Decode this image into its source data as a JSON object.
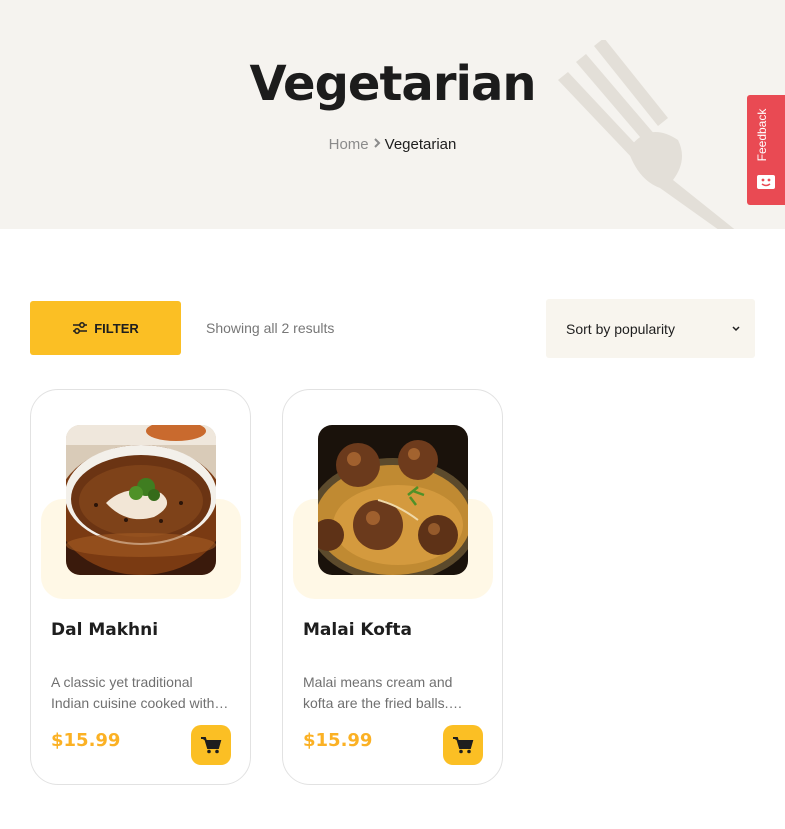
{
  "hero": {
    "title": "Vegetarian",
    "breadcrumb": {
      "home": "Home",
      "separator": "›",
      "current": "Vegetarian"
    }
  },
  "feedback": {
    "label": "Feedback"
  },
  "toolbar": {
    "filter_label": "FILTER",
    "result_count": "Showing all 2 results",
    "sort_selected": "Sort by popularity"
  },
  "products": [
    {
      "title": "Dal Makhni",
      "desc_line1": "A classic yet traditional",
      "desc_line2": "Indian cuisine cooked with…",
      "price": "$15.99",
      "image_icon": "dal-makhni-bowl"
    },
    {
      "title": "Malai Kofta",
      "desc_line1": "Malai means cream and",
      "desc_line2": "kofta are the fried balls.…",
      "price": "$15.99",
      "image_icon": "malai-kofta-plate"
    }
  ],
  "colors": {
    "accent": "#fbbf24",
    "price": "#fbb124",
    "hero_bg": "#f5f3ef",
    "feedback": "#e94a53",
    "card_tint": "#fff8e6"
  }
}
